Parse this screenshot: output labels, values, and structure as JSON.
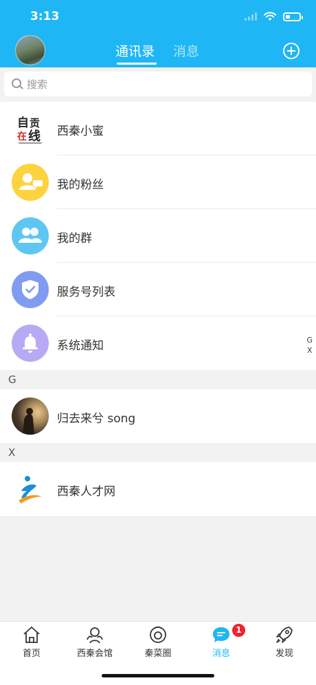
{
  "status": {
    "time": "3:13",
    "battery_level": 0.35
  },
  "header": {
    "tabs": [
      {
        "label": "通讯录",
        "active": true
      },
      {
        "label": "消息",
        "active": false
      }
    ]
  },
  "search": {
    "placeholder": "搜索"
  },
  "top_items": [
    {
      "label": "西秦小蜜",
      "icon": "zixian-logo",
      "logo_text": "自贡在线"
    },
    {
      "label": "我的粉丝",
      "icon": "fans-icon",
      "color": "#fdd33f"
    },
    {
      "label": "我的群",
      "icon": "group-icon",
      "color": "#5fc6f2"
    },
    {
      "label": "服务号列表",
      "icon": "shield-check-icon",
      "color": "#7f9cf0"
    },
    {
      "label": "系统通知",
      "icon": "bell-icon",
      "color": "#b8a9f4"
    }
  ],
  "sections": [
    {
      "letter": "G",
      "contacts": [
        {
          "name": "归去来兮 song",
          "avatar": "photo-avatar"
        }
      ]
    },
    {
      "letter": "X",
      "contacts": [
        {
          "name": "西秦人才网",
          "avatar": "person-logo"
        }
      ]
    }
  ],
  "index_bar": [
    "G",
    "X"
  ],
  "tabbar": {
    "items": [
      {
        "label": "首页",
        "icon": "home-icon",
        "active": false
      },
      {
        "label": "西秦会馆",
        "icon": "hall-icon",
        "active": false
      },
      {
        "label": "秦菜圈",
        "icon": "dish-icon",
        "active": false
      },
      {
        "label": "消息",
        "icon": "message-icon",
        "active": true,
        "badge": "1"
      },
      {
        "label": "发现",
        "icon": "rocket-icon",
        "active": false
      }
    ]
  },
  "colors": {
    "brand": "#1fb6f5",
    "badge": "#f0222d",
    "background": "#f2f2f2"
  }
}
